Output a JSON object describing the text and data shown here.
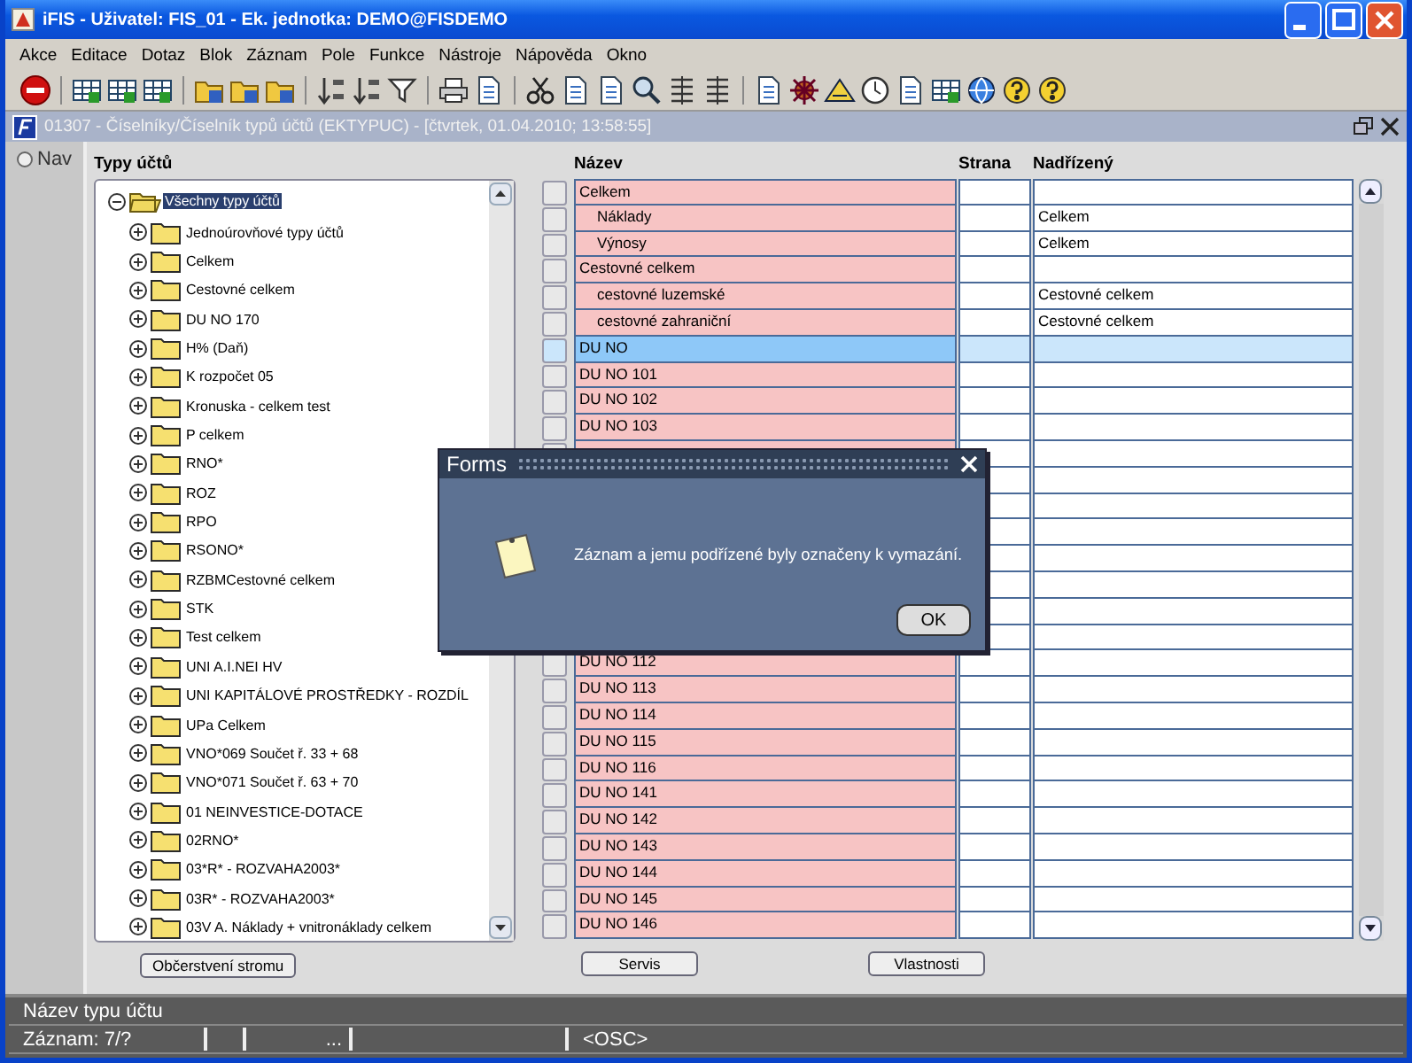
{
  "window": {
    "title": "iFIS - Uživatel: FIS_01 - Ek. jednotka: DEMO@FISDEMO"
  },
  "menu": [
    "Akce",
    "Editace",
    "Dotaz",
    "Blok",
    "Záznam",
    "Pole",
    "Funkce",
    "Nástroje",
    "Nápověda",
    "Okno"
  ],
  "form_window": {
    "title": "01307 - Číselníky/Číselník typů účtů (EKTYPUC) - [čtvrtek, 01.04.2010; 13:58:55]"
  },
  "nav": {
    "label": "Nav"
  },
  "tree": {
    "heading": "Typy účtů",
    "items": [
      {
        "label": "Všechny typy účtů",
        "selected": true,
        "expanded": true,
        "children": [
          {
            "label": "Jednoúrovňové typy účtů",
            "selected": false,
            "expanded": false
          },
          {
            "label": "Celkem",
            "selected": false,
            "expanded": false
          },
          {
            "label": "Cestovné celkem",
            "selected": false,
            "expanded": false
          },
          {
            "label": "DU NO 170",
            "selected": false,
            "expanded": false
          },
          {
            "label": "H% (Daň)",
            "selected": false,
            "expanded": false
          },
          {
            "label": "K rozpočet 05",
            "selected": false,
            "expanded": false
          },
          {
            "label": "Kronuska - celkem test",
            "selected": false,
            "expanded": false
          },
          {
            "label": "P celkem",
            "selected": false,
            "expanded": false
          },
          {
            "label": "RNO*",
            "selected": false,
            "expanded": false
          },
          {
            "label": "ROZ",
            "selected": false,
            "expanded": false
          },
          {
            "label": "RPO",
            "selected": false,
            "expanded": false
          },
          {
            "label": "RSONO*",
            "selected": false,
            "expanded": false
          },
          {
            "label": "RZBMCestovné celkem",
            "selected": false,
            "expanded": false
          },
          {
            "label": "STK",
            "selected": false,
            "expanded": false
          },
          {
            "label": "Test celkem",
            "selected": false,
            "expanded": false
          },
          {
            "label": "UNI A.I.NEI HV",
            "selected": false,
            "expanded": false
          },
          {
            "label": "UNI KAPITÁLOVÉ PROSTŘEDKY - ROZDÍL",
            "selected": false,
            "expanded": false
          },
          {
            "label": "UPa Celkem",
            "selected": false,
            "expanded": false
          },
          {
            "label": "VNO*069 Součet ř. 33 + 68",
            "selected": false,
            "expanded": false
          },
          {
            "label": "VNO*071 Součet ř. 63 + 70",
            "selected": false,
            "expanded": false
          },
          {
            "label": "01 NEINVESTICE-DOTACE",
            "selected": false,
            "expanded": false
          },
          {
            "label": "02RNO*",
            "selected": false,
            "expanded": false
          },
          {
            "label": "03*R* - ROZVAHA2003*",
            "selected": false,
            "expanded": false
          },
          {
            "label": "03R* - ROZVAHA2003*",
            "selected": false,
            "expanded": false
          },
          {
            "label": "03V A. Náklady + vnitronáklady celkem",
            "selected": false,
            "expanded": false
          }
        ]
      }
    ],
    "button": "Občerstvení stromu"
  },
  "table": {
    "columns": [
      "Název",
      "Strana",
      "Nadřízený"
    ],
    "rows": [
      {
        "name": "Celkem",
        "selected": false,
        "children": [
          {
            "name": "Náklady",
            "parent": "Celkem",
            "selected": false
          },
          {
            "name": "Výnosy",
            "parent": "Celkem",
            "selected": false
          }
        ]
      },
      {
        "name": "Cestovné celkem",
        "selected": false,
        "children": [
          {
            "name": "cestovné luzemské",
            "parent": "Cestovné celkem",
            "selected": false
          },
          {
            "name": "cestovné zahraniční",
            "parent": "Cestovné celkem",
            "selected": false
          }
        ]
      },
      {
        "name": "DU NO",
        "selected": true
      },
      {
        "name": "DU NO 101",
        "selected": false
      },
      {
        "name": "DU NO 102",
        "selected": false
      },
      {
        "name": "DU NO 103",
        "selected": false
      },
      {},
      {},
      {},
      {},
      {},
      {},
      {},
      {},
      {
        "name": "DU NO 112",
        "selected": false
      },
      {
        "name": "DU NO 113",
        "selected": false
      },
      {
        "name": "DU NO 114",
        "selected": false
      },
      {
        "name": "DU NO 115",
        "selected": false
      },
      {
        "name": "DU NO 116",
        "selected": false
      },
      {
        "name": "DU NO 141",
        "selected": false
      },
      {
        "name": "DU NO 142",
        "selected": false
      },
      {
        "name": "DU NO 143",
        "selected": false
      },
      {
        "name": "DU NO 144",
        "selected": false
      },
      {
        "name": "DU NO 145",
        "selected": false
      },
      {
        "name": "DU NO 146",
        "selected": false
      }
    ],
    "buttons": [
      "Servis",
      "Vlastnosti"
    ]
  },
  "dialog": {
    "title": "Forms",
    "message": "Záznam a jemu podřízené byly označeny k vymazání.",
    "button": "OK"
  },
  "status_bar": {
    "hint": "Název typu účtu",
    "record": "Záznam: 7/?",
    "ellipsis": "...",
    "mode": "<OSC>"
  }
}
